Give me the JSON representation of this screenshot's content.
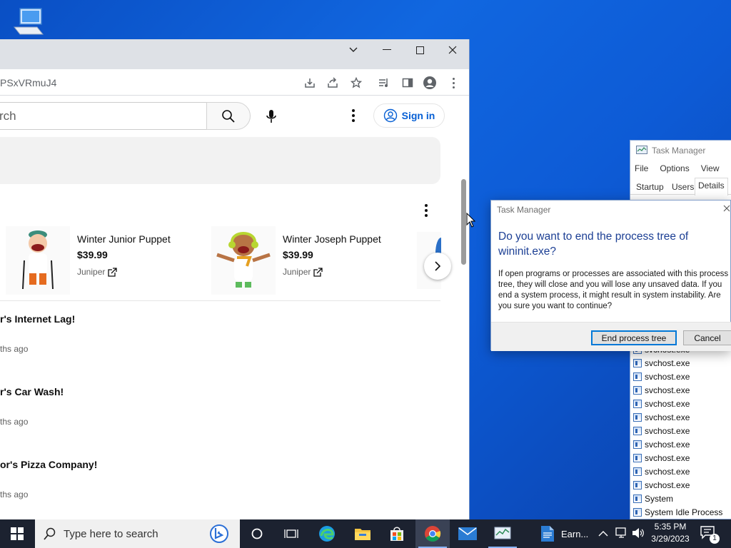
{
  "desktop": {
    "icon_name": "this-pc-icon"
  },
  "chrome": {
    "url_fragment": "PSxVRmuJ4",
    "window_controls": {
      "tab_search": "⌄",
      "minimize": "—",
      "maximize": "☐",
      "close": "✕"
    },
    "youtube": {
      "search_placeholder": "rch",
      "sign_in_label": "Sign in",
      "products": [
        {
          "name": "Winter Junior Puppet",
          "price": "$39.99",
          "store": "Juniper"
        },
        {
          "name": "Winter Joseph Puppet",
          "price": "$39.99",
          "store": "Juniper"
        }
      ],
      "videos": [
        {
          "title": "r's Internet Lag!",
          "meta": "ths ago"
        },
        {
          "title": "r's Car Wash!",
          "meta": "ths ago"
        },
        {
          "title": "or's Pizza Company!",
          "meta": "ths ago"
        }
      ]
    }
  },
  "task_manager": {
    "title": "Task Manager",
    "menu": [
      "File",
      "Options",
      "View"
    ],
    "tabs": [
      "Startup",
      "Users",
      "Details"
    ],
    "active_tab": "Details",
    "processes": [
      "svchost.exe",
      "svchost.exe",
      "svchost.exe",
      "svchost.exe",
      "svchost.exe",
      "svchost.exe",
      "svchost.exe",
      "svchost.exe",
      "svchost.exe",
      "svchost.exe",
      "svchost.exe",
      "System",
      "System Idle Process"
    ]
  },
  "dialog": {
    "title": "Task Manager",
    "heading": "Do you want to end the process tree of wininit.exe?",
    "body": "If open programs or processes are associated with this process tree, they will close and you will lose any unsaved data. If you end a system process, it might result in system instability. Are you sure you want to continue?",
    "confirm_label": "End process tree",
    "cancel_label": "Cancel"
  },
  "taskbar": {
    "search_placeholder": "Type here to search",
    "word_app_label": "Earn...",
    "time": "5:35 PM",
    "date": "3/29/2023",
    "notification_count": "1"
  },
  "colors": {
    "desktop": "#0d5bd6",
    "youtube_blue": "#065fd4",
    "dialog_heading": "#1c3f94",
    "taskbar": "#1c2230"
  }
}
